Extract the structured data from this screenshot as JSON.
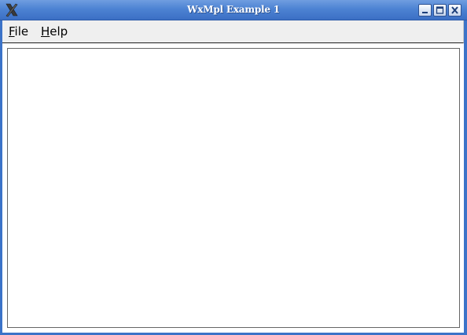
{
  "window": {
    "title": "WxMpl Example 1",
    "icons": {
      "app": "x-app-icon",
      "minimize": "minimize-icon",
      "maximize": "maximize-icon",
      "close": "close-icon"
    }
  },
  "menubar": {
    "file": {
      "mnemonic": "F",
      "rest": "ile"
    },
    "help": {
      "mnemonic": "H",
      "rest": "elp"
    }
  },
  "colors": {
    "titlebar": "#4d83d3",
    "menubar": "#efefef",
    "canvas": "#ffffff",
    "plot_border": "#666666"
  }
}
